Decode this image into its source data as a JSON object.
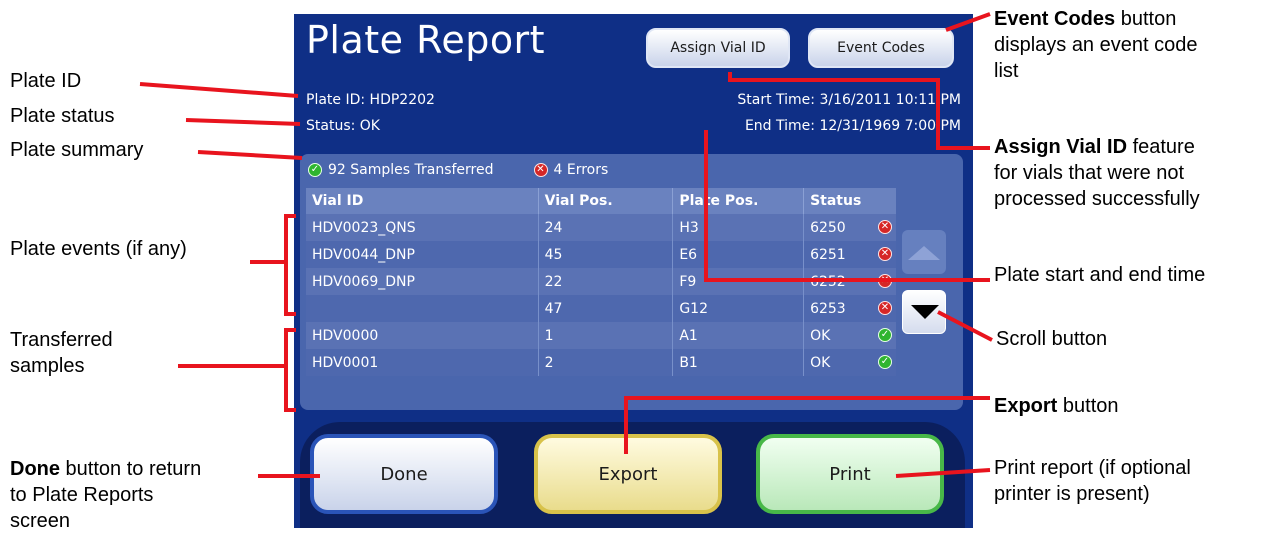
{
  "screen": {
    "title": "Plate Report",
    "assign_vial_label": "Assign Vial ID",
    "event_codes_label": "Event Codes",
    "plate_id": "Plate ID: HDP2202",
    "status": "Status: OK",
    "start_time": "Start Time: 3/16/2011  10:11 PM",
    "end_time": "End Time: 12/31/1969  7:00 PM",
    "summary": {
      "transferred": "92 Samples Transferred",
      "errors": "4 Errors"
    },
    "table": {
      "headers": [
        "Vial ID",
        "Vial Pos.",
        "Plate Pos.",
        "Status"
      ],
      "rows": [
        {
          "vial_id": "HDV0023_QNS",
          "vial_pos": "24",
          "plate_pos": "H3",
          "status": "6250",
          "icon": "error-icon"
        },
        {
          "vial_id": "HDV0044_DNP",
          "vial_pos": "45",
          "plate_pos": "E6",
          "status": "6251",
          "icon": "error-icon"
        },
        {
          "vial_id": "HDV0069_DNP",
          "vial_pos": "22",
          "plate_pos": "F9",
          "status": "6252",
          "icon": "error-icon"
        },
        {
          "vial_id": "",
          "vial_pos": "47",
          "plate_pos": "G12",
          "status": "6253",
          "icon": "error-icon"
        },
        {
          "vial_id": "HDV0000",
          "vial_pos": "1",
          "plate_pos": "A1",
          "status": "OK",
          "icon": "ok-icon"
        },
        {
          "vial_id": "HDV0001",
          "vial_pos": "2",
          "plate_pos": "B1",
          "status": "OK",
          "icon": "ok-icon"
        }
      ]
    },
    "buttons": {
      "done": "Done",
      "export": "Export",
      "print": "Print"
    }
  },
  "callouts": {
    "plate_id": "Plate ID",
    "plate_status": "Plate status",
    "plate_summary": "Plate summary",
    "plate_events": "Plate events (if any)",
    "transferred_1": "Transferred",
    "transferred_2": "samples",
    "done_bold": "Done",
    "done_rest_1": " button to return",
    "done_rest_2": "to Plate Reports",
    "done_rest_3": "screen",
    "event_codes_bold": "Event Codes",
    "event_codes_rest_1": " button",
    "event_codes_rest_2": "displays an event code",
    "event_codes_rest_3": "list",
    "assign_bold": "Assign Vial ID",
    "assign_rest_1": " feature",
    "assign_rest_2": "for vials that were not",
    "assign_rest_3": "processed successfully",
    "start_end": "Plate start and end time",
    "scroll": "Scroll button",
    "export_bold": "Export",
    "export_rest": " button",
    "print_1": "Print report (if optional",
    "print_2": "printer is present)"
  },
  "colors": {
    "screen_bg": "#0f2f86",
    "panel_bg": "#4a66ad",
    "callout_line": "#e8141e",
    "error": "#d62727",
    "ok": "#2fb52f"
  }
}
